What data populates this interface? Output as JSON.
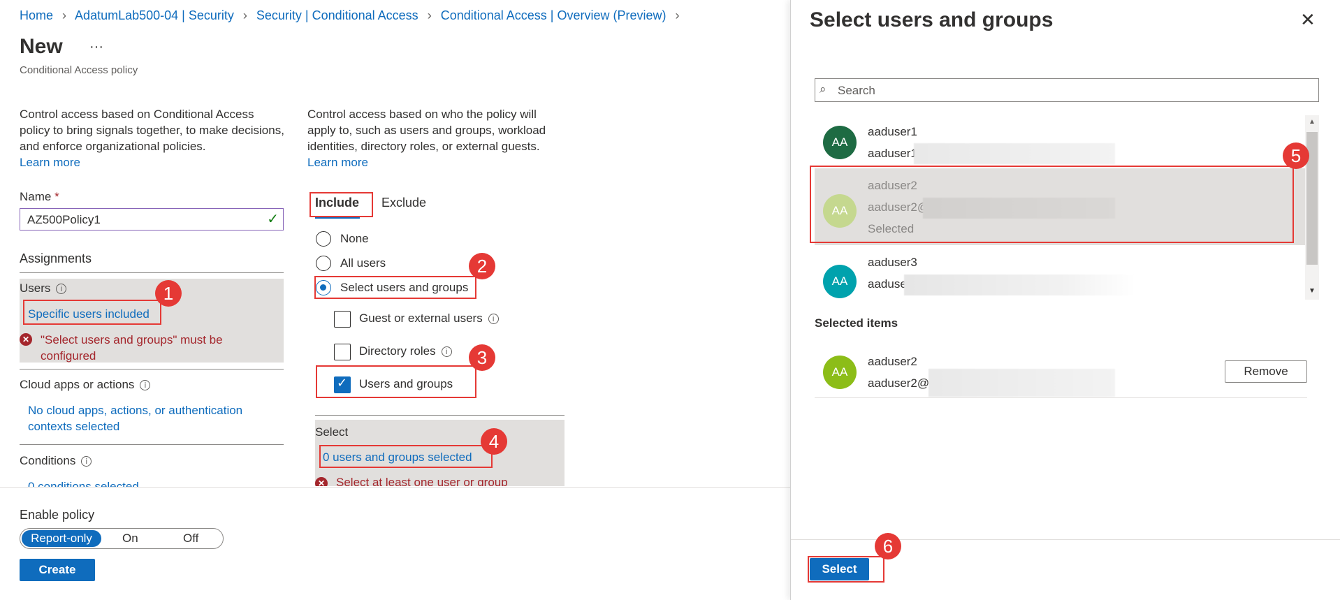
{
  "breadcrumb": {
    "items": [
      "Home",
      "AdatumLab500-04 | Security",
      "Security | Conditional Access",
      "Conditional Access | Overview (Preview)"
    ],
    "separator": ">"
  },
  "page": {
    "title": "New",
    "more": "···",
    "subtitle": "Conditional Access policy"
  },
  "left_col": {
    "description": "Control access based on Conditional Access policy to bring signals together, to make decisions, and enforce organizational policies.",
    "learn_more": "Learn more",
    "name_label": "Name",
    "name_required": "*",
    "name_value": "AZ500Policy1",
    "assignments_heading": "Assignments",
    "users_label": "Users",
    "users_link": "Specific users included",
    "users_error": "\"Select users and groups\" must be configured",
    "cloud_label": "Cloud apps or actions",
    "cloud_link": "No cloud apps, actions, or authentication contexts selected",
    "conditions_label": "Conditions",
    "conditions_link": "0 conditions selected"
  },
  "mid_col": {
    "description": "Control access based on who the policy will apply to, such as users and groups, workload identities, directory roles, or external guests.",
    "learn_more": "Learn more",
    "tabs": [
      "Include",
      "Exclude"
    ],
    "radios": [
      "None",
      "All users",
      "Select users and groups"
    ],
    "checkboxes": [
      "Guest or external users",
      "Directory roles",
      "Users and groups"
    ],
    "select_label": "Select",
    "select_link": "0 users and groups selected",
    "select_error": "Select at least one user or group"
  },
  "footer": {
    "enable_label": "Enable policy",
    "toggle": [
      "Report-only",
      "On",
      "Off"
    ],
    "toggle_selected": "Report-only",
    "create": "Create"
  },
  "panel": {
    "title": "Select users and groups",
    "search_placeholder": "Search",
    "users": [
      {
        "initials": "AA",
        "name": "aaduser1",
        "email": "aaduser1",
        "color": "#1e6b43",
        "selected": false
      },
      {
        "initials": "AA",
        "name": "aaduser2",
        "email": "aaduser2@",
        "status": "Selected",
        "color": "#8cbd18",
        "selected": true
      },
      {
        "initials": "AA",
        "name": "aaduser3",
        "email": "aaduse",
        "color": "#00a2ad",
        "selected": false
      }
    ],
    "selected_heading": "Selected items",
    "selected_items": [
      {
        "initials": "AA",
        "name": "aaduser2",
        "email": "aaduser2@l",
        "color": "#8cbd18",
        "remove": "Remove"
      }
    ],
    "select_button": "Select"
  },
  "callouts": [
    "1",
    "2",
    "3",
    "4",
    "5",
    "6"
  ],
  "colors": {
    "accent": "#0f6cbd",
    "callout": "#e53935",
    "error": "#a4262c",
    "success": "#107c10"
  }
}
